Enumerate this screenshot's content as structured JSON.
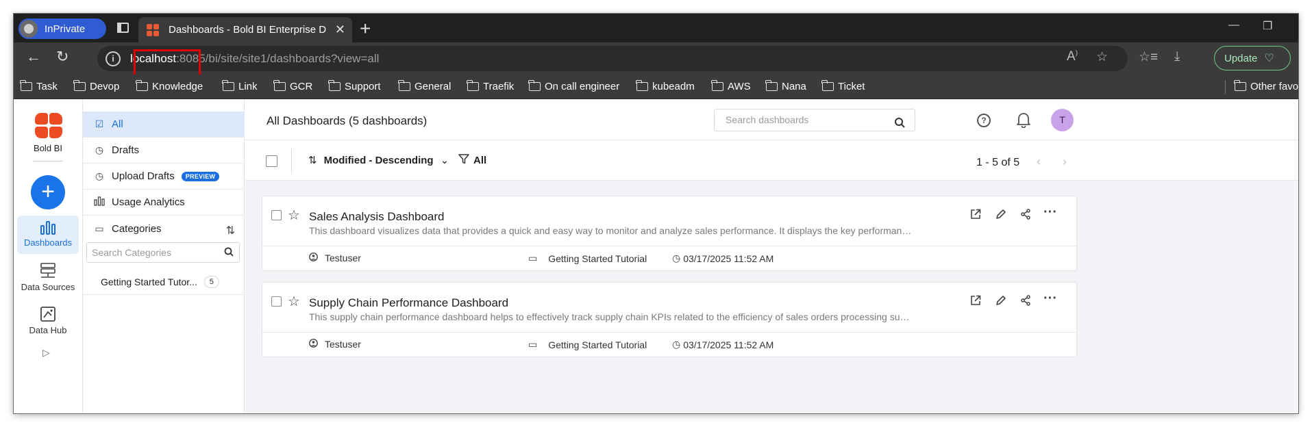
{
  "browser": {
    "inprivate_label": "InPrivate",
    "tab_title": "Dashboards - Bold BI Enterprise D",
    "url_host": "localhost",
    "url_rest": ":8085/bi/site/site1/dashboards?view=all",
    "update_label": "Update",
    "bookmarks": [
      "Task",
      "Devop",
      "Knowledge",
      "Link",
      "GCR",
      "Support",
      "General",
      "Traefik",
      "On call engineer",
      "kubeadm",
      "AWS",
      "Nana",
      "Ticket"
    ],
    "other_favorites": "Other favor"
  },
  "leftnav": {
    "logo_text": "Bold BI",
    "items": [
      {
        "label": "Dashboards",
        "icon": "bar-chart-icon"
      },
      {
        "label": "Data Sources",
        "icon": "database-icon"
      },
      {
        "label": "Data Hub",
        "icon": "datahub-icon"
      }
    ]
  },
  "sidebar": {
    "items": [
      {
        "label": "All",
        "icon": "checkbox-icon"
      },
      {
        "label": "Drafts",
        "icon": "clock-icon"
      },
      {
        "label": "Upload Drafts",
        "icon": "clock-icon",
        "badge": "PREVIEW"
      },
      {
        "label": "Usage Analytics",
        "icon": "bar-chart-icon"
      },
      {
        "label": "Categories",
        "icon": "folder-icon"
      }
    ],
    "category_search_placeholder": "Search Categories",
    "categories": [
      {
        "name": "Getting Started Tutor...",
        "count": "5"
      }
    ]
  },
  "header": {
    "title": "All Dashboards (5 dashboards)",
    "search_placeholder": "Search dashboards",
    "avatar_initial": "T"
  },
  "toolbar": {
    "sort_label": "Modified - Descending",
    "filter_label": "All",
    "pagination": "1 - 5 of 5"
  },
  "dashboards": [
    {
      "title": "Sales Analysis Dashboard",
      "description": "This dashboard visualizes data that provides a quick and easy way to monitor and analyze sales performance. It displays the key performance indicato...",
      "owner": "Testuser",
      "category": "Getting Started Tutorial",
      "modified": "03/17/2025 11:52 AM"
    },
    {
      "title": "Supply Chain Performance Dashboard",
      "description": "This supply chain performance dashboard helps to effectively track supply chain KPIs related to the efficiency of sales orders processing such as cash...",
      "owner": "Testuser",
      "category": "Getting Started Tutorial",
      "modified": "03/17/2025 11:52 AM"
    }
  ],
  "colors": {
    "accent": "#1a73e8",
    "brand": "#ef4b23",
    "annotation_box": "#e00000"
  }
}
